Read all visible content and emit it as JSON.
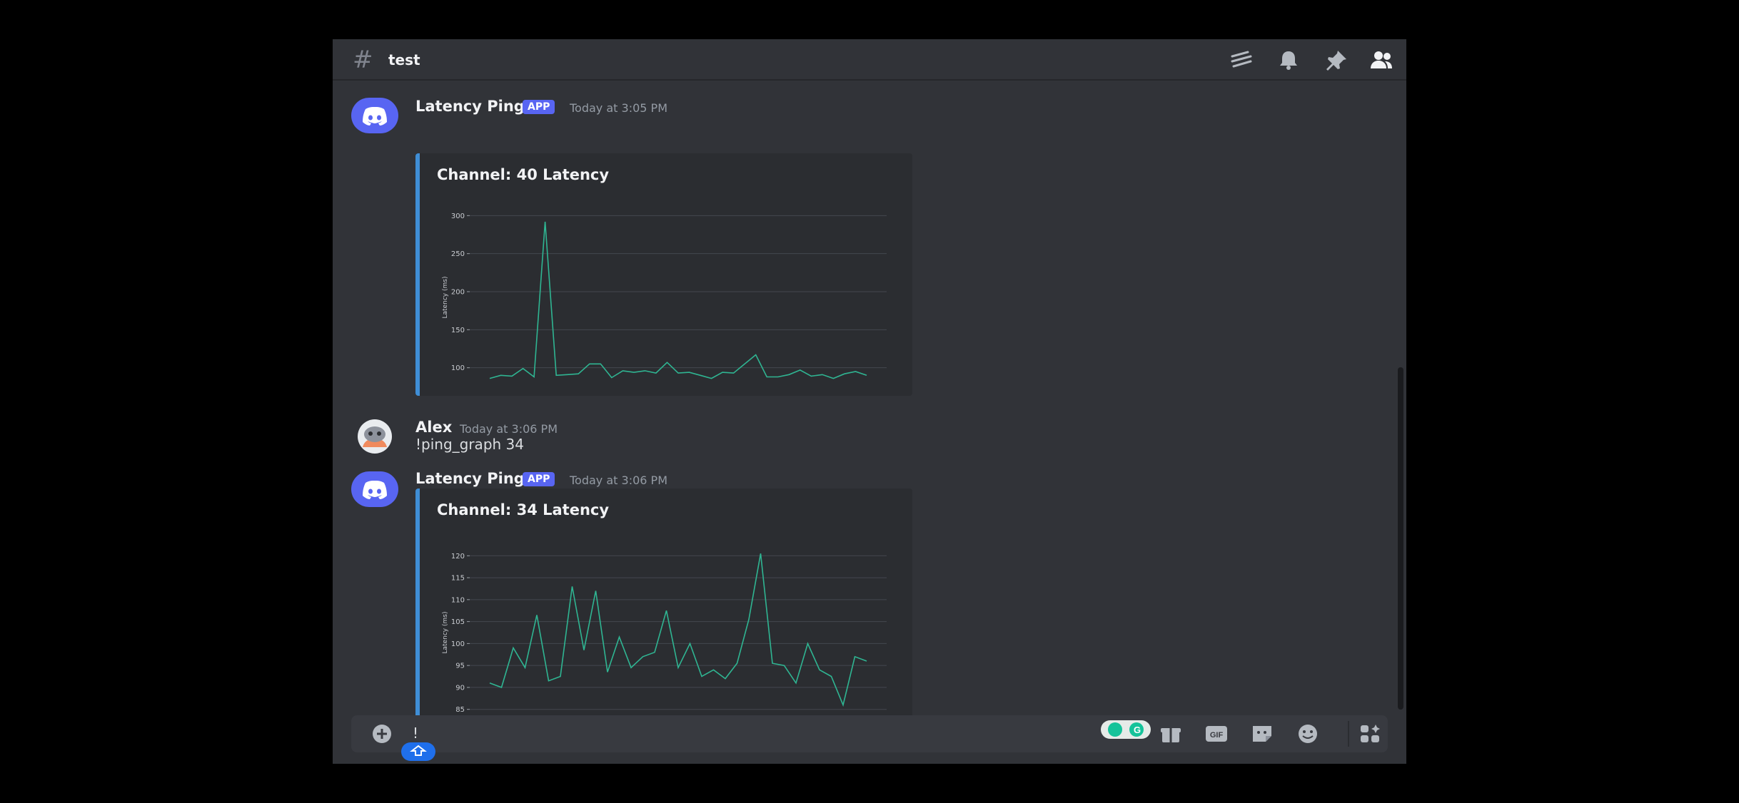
{
  "header": {
    "hash_icon": "hash-icon",
    "channel_name": "test",
    "icons": [
      "threads-icon",
      "bell-icon",
      "pin-icon",
      "members-icon"
    ]
  },
  "messages": [
    {
      "author": "Latency Ping",
      "badge": "APP",
      "timestamp": "Today at 3:05 PM",
      "avatar": "discord-logo-icon",
      "embed_title": "Channel: 40 Latency"
    },
    {
      "author": "Alex",
      "timestamp": "Today at 3:06 PM",
      "avatar": "user-avatar",
      "text": "!ping_graph 34"
    },
    {
      "author": "Latency Ping",
      "badge": "APP",
      "timestamp": "Today at 3:06 PM",
      "avatar": "discord-logo-icon",
      "embed_title": "Channel: 34 Latency"
    }
  ],
  "composer": {
    "value": "!",
    "icons": [
      "add-icon",
      "grammarly-icon",
      "gift-icon",
      "gif-icon",
      "sticker-icon",
      "emoji-icon",
      "apps-icon"
    ],
    "gif_label": "GIF"
  },
  "colors": {
    "accent": "#5865f2",
    "line": "#2fb592",
    "embed_bar": "#3f8ed6",
    "bg": "#313338"
  },
  "chart_data": [
    {
      "type": "line",
      "title": "",
      "xlabel": "",
      "ylabel": "Latency (ms)",
      "yticks": [
        100,
        150,
        200,
        250,
        300
      ],
      "ylim": [
        80,
        305
      ],
      "grid": true,
      "series": [
        {
          "values": [
            86,
            90,
            89,
            99,
            88,
            292,
            90,
            91,
            92,
            105,
            105,
            87,
            96,
            94,
            96,
            93,
            107,
            93,
            94,
            90,
            86,
            94,
            93,
            105,
            117,
            88,
            88,
            91,
            97,
            89,
            91,
            86,
            92,
            95,
            90
          ]
        }
      ]
    },
    {
      "type": "line",
      "title": "",
      "xlabel": "",
      "ylabel": "Latency (ms)",
      "yticks": [
        85,
        90,
        95,
        100,
        105,
        110,
        115,
        120
      ],
      "ylim": [
        83,
        122
      ],
      "grid": true,
      "series": [
        {
          "values": [
            91,
            90,
            99,
            94.5,
            106.5,
            91.5,
            92.5,
            113,
            98.5,
            112,
            93.5,
            101.5,
            94.5,
            97,
            98,
            107.5,
            94.5,
            100,
            92.5,
            94,
            92,
            95.5,
            105.5,
            120.5,
            95.5,
            95,
            91,
            100,
            94,
            92.5,
            86,
            97,
            96
          ]
        }
      ]
    }
  ]
}
